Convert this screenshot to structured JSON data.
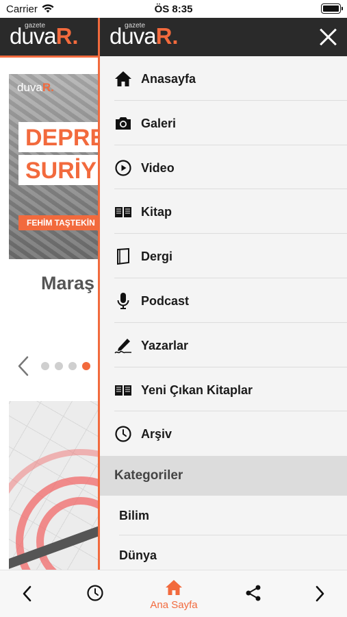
{
  "status_bar": {
    "carrier": "Carrier",
    "time": "ÖS 8:35"
  },
  "brand": {
    "gazete": "gazete",
    "name": "duva",
    "name_accent": "R.",
    "accent_color": "#f26a3d",
    "header_color": "#2a2a2a"
  },
  "background_page": {
    "card": {
      "line1": "DEPRE",
      "line2": "SURİY",
      "byline": "FEHİM TAŞTEKİN"
    },
    "headline": "Maraş",
    "slider_dots": 4,
    "slider_active_dot": 4
  },
  "drawer": {
    "menu": [
      {
        "label": "Anasayfa",
        "icon": "home-icon"
      },
      {
        "label": "Galeri",
        "icon": "camera-icon"
      },
      {
        "label": "Video",
        "icon": "play-circle-icon"
      },
      {
        "label": "Kitap",
        "icon": "open-book-icon"
      },
      {
        "label": "Dergi",
        "icon": "magazine-icon"
      },
      {
        "label": "Podcast",
        "icon": "microphone-icon"
      },
      {
        "label": "Yazarlar",
        "icon": "pen-signature-icon"
      },
      {
        "label": "Yeni Çıkan Kitaplar",
        "icon": "open-book-icon"
      },
      {
        "label": "Arşiv",
        "icon": "clock-icon"
      }
    ],
    "section_title": "Kategoriler",
    "categories": [
      "Bilim",
      "Dünya"
    ]
  },
  "bottom_bar": {
    "home_label": "Ana Sayfa",
    "icons": [
      "back-arrow-icon",
      "clock-icon",
      "home-icon",
      "share-icon",
      "forward-arrow-icon"
    ]
  }
}
